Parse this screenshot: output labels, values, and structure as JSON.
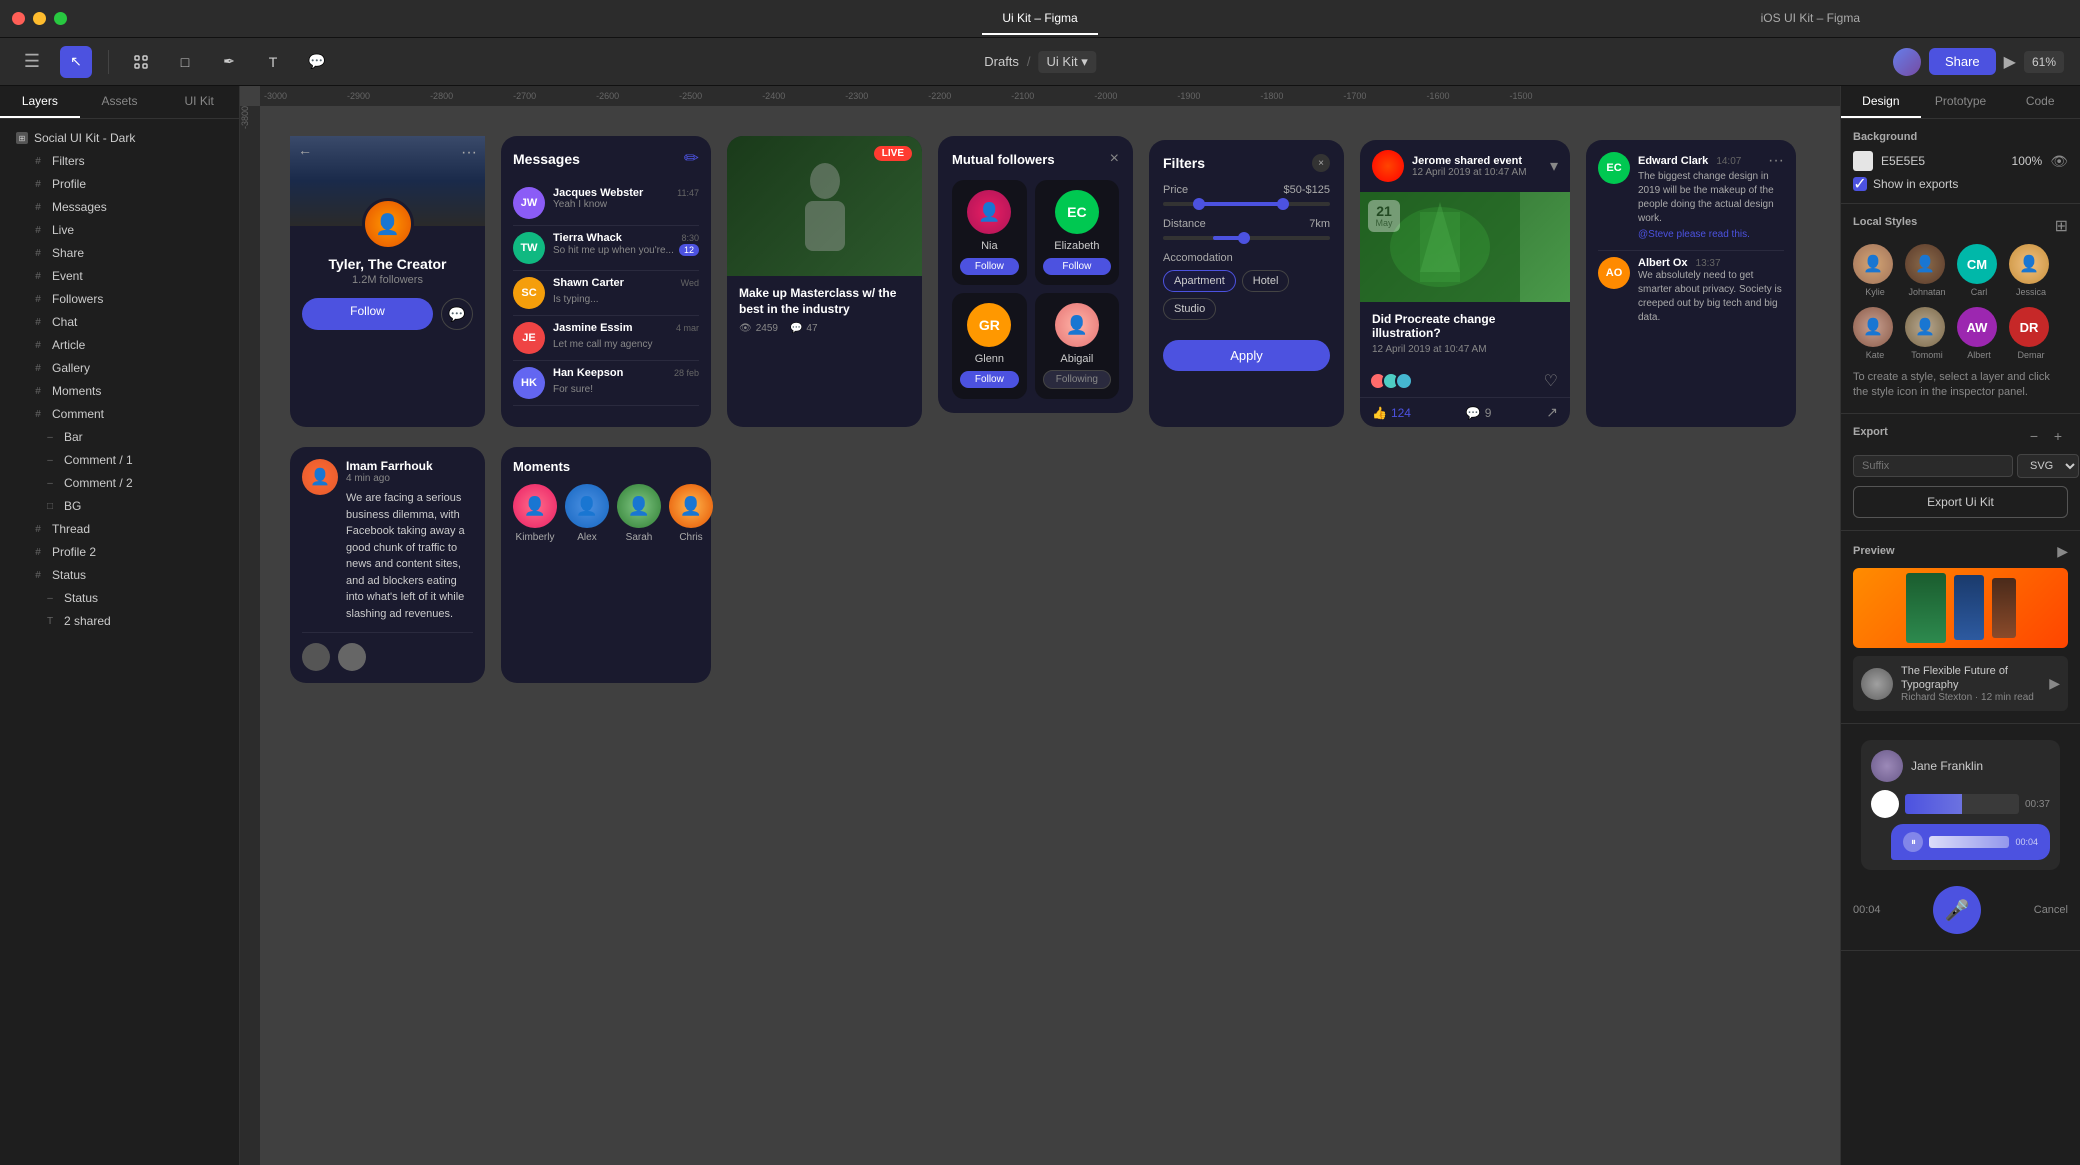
{
  "app": {
    "title": "Ui Kit – Figma",
    "tab1": "Ui Kit – Figma",
    "tab2": "iOS UI Kit – Figma"
  },
  "toolbar": {
    "breadcrumb": "Drafts / Ui Kit",
    "zoom": "61%",
    "share_label": "Share"
  },
  "sidebar": {
    "tab1": "Layers",
    "tab2": "Assets",
    "tab3": "UI Kit",
    "root": "Social UI Kit - Dark",
    "items": [
      "Filters",
      "Profile",
      "Messages",
      "Live",
      "Share",
      "Event",
      "Followers",
      "Chat",
      "Article",
      "Gallery",
      "Moments",
      "Comment",
      "Bar",
      "Comment / 1",
      "Comment / 2",
      "BG",
      "Thread",
      "Profile 2",
      "Status",
      "Status",
      "2 shared"
    ]
  },
  "right_panel": {
    "tab1": "Design",
    "tab2": "Prototype",
    "tab3": "Code",
    "background_label": "Background",
    "bg_color": "E5E5E5",
    "bg_opacity": "100%",
    "show_exports": "Show in exports",
    "local_styles_title": "Local Styles",
    "local_styles_hint": "To create a style, select a layer and click the style icon in the inspector panel.",
    "export_title": "Export",
    "export_suffix_placeholder": "Suffix",
    "export_format": "SVG",
    "export_btn": "Export Ui Kit",
    "preview_label": "Preview",
    "preview_article_title": "The Flexible Future of Typography",
    "preview_article_meta": "Richard Stexton · 12 min read",
    "audio_user": "Jane Franklin",
    "audio_duration": "00:37",
    "audio_time2": "00:04",
    "cancel_label": "Cancel"
  },
  "avatars": {
    "share_people": [
      "Kylie",
      "Johnatan",
      "Carl",
      "Jessica",
      "Kate",
      "Tomomi",
      "Albert",
      "Demar"
    ]
  },
  "profile_card": {
    "name": "Tyler, The Creator",
    "followers": "1.2M followers",
    "follow_btn": "Follow"
  },
  "messages_card": {
    "title": "Messages",
    "items": [
      {
        "name": "Jacques Webster",
        "text": "Yeah I know",
        "time": "11:47",
        "avatar_bg": "#8b5cf6",
        "initials": "JW"
      },
      {
        "name": "Tierra Whack",
        "text": "So hit me up when you're...",
        "time": "8:30",
        "avatar_bg": "#10b981",
        "initials": "TW",
        "badge": "12"
      },
      {
        "name": "Shawn Carter",
        "text": "Is typing...",
        "time": "Wed",
        "avatar_bg": "#f59e0b",
        "initials": "SC"
      },
      {
        "name": "Jasmine Essim",
        "text": "Let me call my agency",
        "time": "4 mar",
        "avatar_bg": "#ef4444",
        "initials": "JE"
      },
      {
        "name": "Han Keepson",
        "text": "For sure!",
        "time": "28 feb",
        "avatar_bg": "#6366f1",
        "initials": "HK"
      }
    ]
  },
  "live_card": {
    "badge": "LIVE",
    "title": "Make up Masterclass w/ the best in the industry",
    "views": "2459",
    "comments": "47"
  },
  "filters_card": {
    "title": "Filters",
    "price_label": "Price",
    "price_value": "$50-$125",
    "distance_label": "Distance",
    "distance_value": "7km",
    "accomodation_label": "Accomodation",
    "options": [
      "Apartment",
      "Hotel",
      "Studio"
    ],
    "apply_btn": "Apply"
  },
  "mutual_card": {
    "title": "Mutual followers",
    "people": [
      {
        "name": "Nia",
        "btn": "Follow",
        "color": "#e91e63"
      },
      {
        "name": "Elizabeth",
        "btn": "Follow",
        "color": "#00c851",
        "initials": "EC"
      },
      {
        "name": "Glenn",
        "btn": "Follow",
        "color": "#ff9800",
        "initials": "GR"
      },
      {
        "name": "Abigail",
        "btn": "Following",
        "color": "#ff8a80"
      }
    ]
  },
  "feed_card": {
    "user": "Jerome shared event",
    "time": "12 April 2019 at 10:47 AM",
    "date_day": "21",
    "date_month": "May",
    "title": "Did Procreate change illustration?",
    "subtitle": "12 April 2019 at 10:47 AM",
    "likes": "124",
    "comments": "9"
  },
  "thread_card": {
    "user": "Imam Farrhouk",
    "time": "4 min ago",
    "text": "We are facing a serious business dilemma, with Facebook taking away a good chunk of traffic to news and content sites, and ad blockers eating into what's left of it while slashing ad revenues."
  },
  "ec_messages": [
    {
      "badge": "EC",
      "name": "Edward Clark",
      "time": "14:07",
      "text": "The biggest change design in 2019 will be the makeup of the people doing the actual design work.",
      "mention": "@Steve please read this.",
      "bg": "#00c851"
    },
    {
      "badge": "AO",
      "name": "Albert Ox",
      "time": "13:37",
      "text": "We absolutely need to get smarter about privacy. Society is creeped out by big tech and big data.",
      "bg": "#ff8a00"
    }
  ],
  "moments_card": {
    "title": "Moments",
    "people": [
      "Kimberly",
      "Alex",
      "Sarah",
      "Chris"
    ]
  }
}
